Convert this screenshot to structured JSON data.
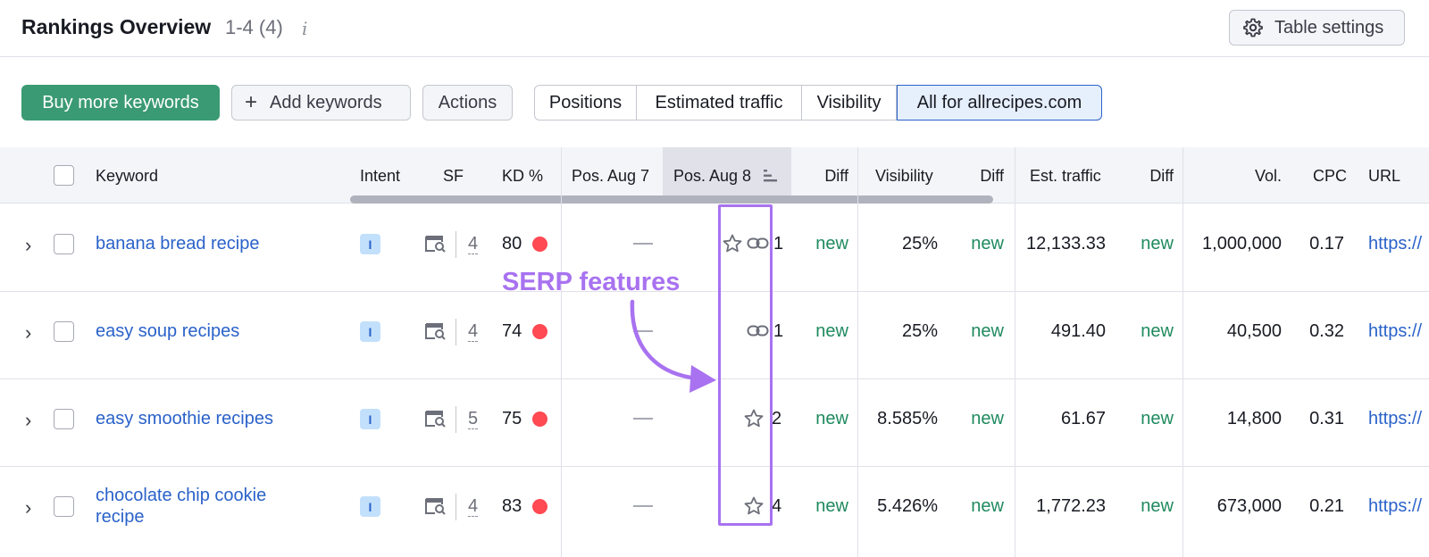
{
  "header": {
    "title": "Rankings Overview",
    "count": "1-4 (4)",
    "info_icon": "i",
    "table_settings_label": "Table settings"
  },
  "toolbar": {
    "buy_label": "Buy more keywords",
    "add_label": "Add keywords",
    "actions_label": "Actions",
    "tabs": [
      {
        "label": "Positions"
      },
      {
        "label": "Estimated traffic"
      },
      {
        "label": "Visibility"
      },
      {
        "label": "All for allrecipes.com"
      }
    ]
  },
  "columns": {
    "keyword": "Keyword",
    "intent": "Intent",
    "sf": "SF",
    "kd": "KD %",
    "pos1": "Pos. Aug 7",
    "pos2": "Pos. Aug 8",
    "diff1": "Diff",
    "visibility": "Visibility",
    "diff2": "Diff",
    "traffic": "Est. traffic",
    "diff3": "Diff",
    "vol": "Vol.",
    "cpc": "CPC",
    "url": "URL"
  },
  "rows": [
    {
      "keyword": "banana bread recipe",
      "intent": "I",
      "sf": "4",
      "kd": "80",
      "pos": "1",
      "diff1": "new",
      "visibility": "25%",
      "diff2": "new",
      "traffic": "12,133.33",
      "diff3": "new",
      "vol": "1,000,000",
      "cpc": "0.17",
      "url": "https://"
    },
    {
      "keyword": "easy soup recipes",
      "intent": "I",
      "sf": "4",
      "kd": "74",
      "pos": "1",
      "diff1": "new",
      "visibility": "25%",
      "diff2": "new",
      "traffic": "491.40",
      "diff3": "new",
      "vol": "40,500",
      "cpc": "0.32",
      "url": "https://"
    },
    {
      "keyword": "easy smoothie recipes",
      "intent": "I",
      "sf": "5",
      "kd": "75",
      "pos": "2",
      "diff1": "new",
      "visibility": "8.585%",
      "diff2": "new",
      "traffic": "61.67",
      "diff3": "new",
      "vol": "14,800",
      "cpc": "0.31",
      "url": "https://"
    },
    {
      "keyword_line1": "chocolate chip cookie",
      "keyword_line2": "recipe",
      "intent": "I",
      "sf": "4",
      "kd": "83",
      "pos": "4",
      "diff1": "new",
      "visibility": "5.426%",
      "diff2": "new",
      "traffic": "1,772.23",
      "diff3": "new",
      "vol": "673,000",
      "cpc": "0.21",
      "url": "https://"
    }
  ],
  "annotation": {
    "label": "SERP features"
  },
  "colors": {
    "brand_green": "#3a9a73",
    "link_blue": "#2a62c9",
    "annotation_purple": "#a872f0",
    "kd_red": "#ff4953"
  }
}
